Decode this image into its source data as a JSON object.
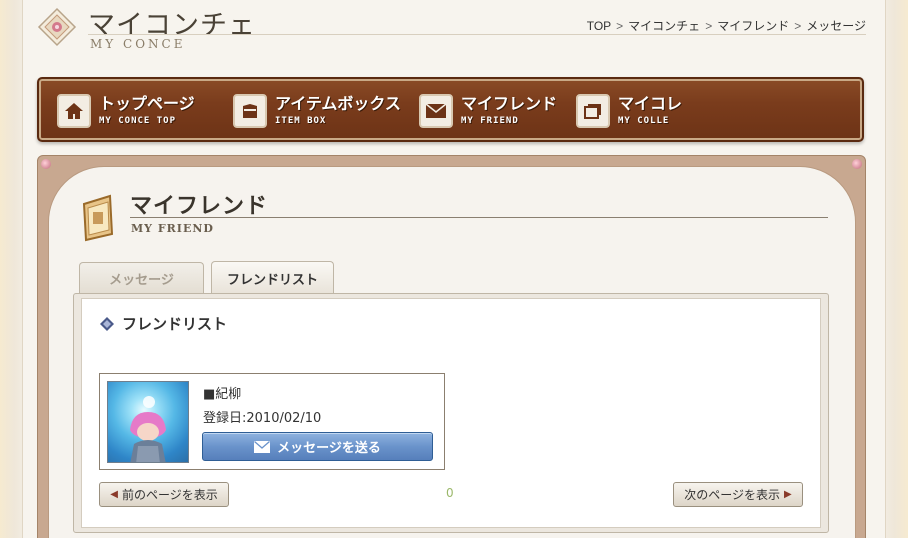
{
  "header": {
    "logo_jp": "マイコンチェ",
    "logo_en": "MY CONCE",
    "breadcrumb": [
      "TOP",
      "マイコンチェ",
      "マイフレンド",
      "メッセージ"
    ],
    "breadcrumb_sep": ">"
  },
  "nav": {
    "items": [
      {
        "label": "トップページ",
        "sub": "MY CONCE TOP",
        "icon": "home-icon"
      },
      {
        "label": "アイテムボックス",
        "sub": "ITEM BOX",
        "icon": "box-icon"
      },
      {
        "label": "マイフレンド",
        "sub": "MY FRIEND",
        "icon": "envelope-icon"
      },
      {
        "label": "マイコレ",
        "sub": "MY COLLE",
        "icon": "frames-icon"
      }
    ]
  },
  "section": {
    "title": "マイフレンド",
    "subtitle": "MY FRIEND"
  },
  "tabs": [
    {
      "label": "メッセージ",
      "active": false
    },
    {
      "label": "フレンドリスト",
      "active": true
    }
  ],
  "friend_list": {
    "title": "フレンドリスト",
    "friends": [
      {
        "name": "■紀柳",
        "registered": "登録日:2010/02/10",
        "action": "メッセージを送る"
      }
    ],
    "prev_label": "前のページを表示",
    "next_label": "次のページを表示",
    "page": "0"
  },
  "colors": {
    "nav_wood": "#7a3c1c",
    "send_button": "#6a93cb",
    "frame": "#c8a890"
  }
}
